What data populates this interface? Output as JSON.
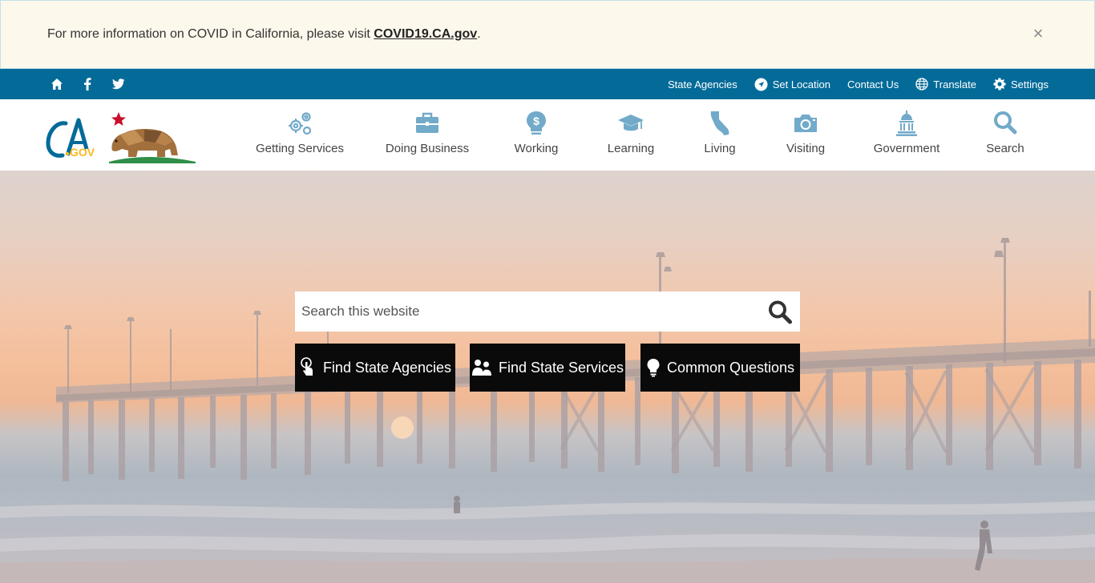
{
  "alert": {
    "text": "For more information on COVID in California, please visit ",
    "link": "COVID19.CA.gov",
    "suffix": ".",
    "close": "×"
  },
  "utility": {
    "social": [
      "home-icon",
      "facebook-icon",
      "twitter-icon"
    ],
    "links": {
      "agencies": "State Agencies",
      "location": "Set Location",
      "contact": "Contact Us",
      "translate": "Translate",
      "settings": "Settings"
    }
  },
  "nav": {
    "items": [
      {
        "label": "Getting Services",
        "icon": "gears-icon"
      },
      {
        "label": "Doing Business",
        "icon": "briefcase-icon"
      },
      {
        "label": "Working",
        "icon": "lightbulb-dollar-icon"
      },
      {
        "label": "Learning",
        "icon": "graduation-cap-icon"
      },
      {
        "label": "Living",
        "icon": "california-icon"
      },
      {
        "label": "Visiting",
        "icon": "camera-icon"
      },
      {
        "label": "Government",
        "icon": "capitol-icon"
      },
      {
        "label": "Search",
        "icon": "search-icon"
      }
    ]
  },
  "hero": {
    "search_placeholder": "Search this website",
    "buttons": {
      "agencies": "Find State Agencies",
      "services": "Find State Services",
      "questions": "Common Questions"
    }
  },
  "colors": {
    "utility_bar": "#046b99",
    "nav_icon": "#72aac9",
    "alert_bg": "#fdf8ec"
  }
}
